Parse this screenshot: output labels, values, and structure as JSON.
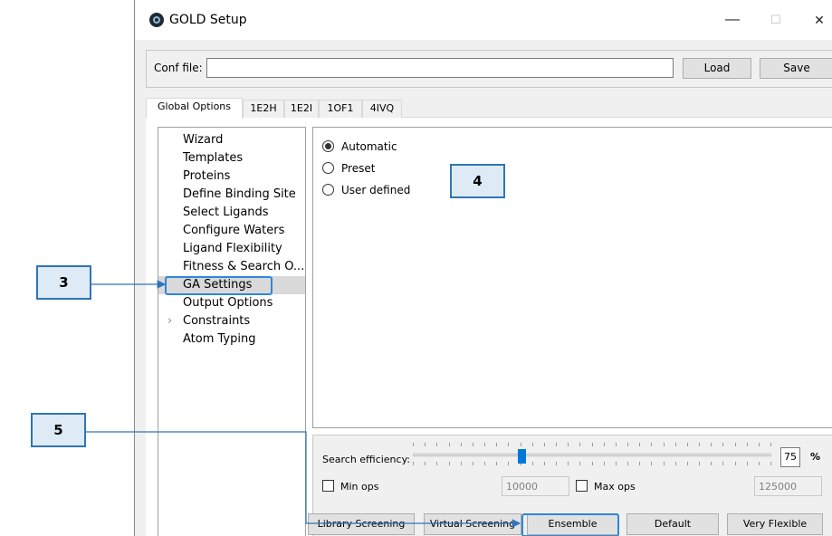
{
  "window": {
    "title": "GOLD Setup",
    "controls": {
      "minimize": "—",
      "maximize": "☐",
      "close": "✕"
    }
  },
  "conf": {
    "label": "Conf file:",
    "value": "",
    "load_label": "Load",
    "save_label": "Save"
  },
  "tabs": [
    {
      "label": "Global Options",
      "active": true
    },
    {
      "label": "1E2H"
    },
    {
      "label": "1E2I"
    },
    {
      "label": "1OF1"
    },
    {
      "label": "4IVQ"
    }
  ],
  "nav": {
    "items": [
      {
        "label": "Wizard"
      },
      {
        "label": "Templates"
      },
      {
        "label": "Proteins"
      },
      {
        "label": "Define Binding Site"
      },
      {
        "label": "Select Ligands"
      },
      {
        "label": "Configure Waters"
      },
      {
        "label": "Ligand Flexibility"
      },
      {
        "label": "Fitness & Search O..."
      },
      {
        "label": "GA Settings",
        "selected": true
      },
      {
        "label": "Output Options"
      },
      {
        "label": "Constraints",
        "expandable": true
      },
      {
        "label": "Atom Typing"
      }
    ]
  },
  "ga": {
    "presets": [
      {
        "label": "Automatic",
        "checked": true
      },
      {
        "label": "Preset",
        "checked": false
      },
      {
        "label": "User defined",
        "checked": false
      }
    ],
    "search_efficiency_label": "Search efficiency:",
    "search_efficiency_value": "75",
    "search_efficiency_unit": "%",
    "slider_fraction": 0.3,
    "min_ops_label": "Min ops",
    "min_ops_value": "10000",
    "max_ops_label": "Max ops",
    "max_ops_value": "125000",
    "buttons": {
      "library_screening": "Library Screening",
      "virtual_screening": "Virtual Screening",
      "ensemble": "Ensemble",
      "default": "Default",
      "very_flexible": "Very Flexible"
    }
  },
  "annotations": {
    "step3": "3",
    "step4": "4",
    "step5": "5",
    "color": "#2e75b6"
  }
}
